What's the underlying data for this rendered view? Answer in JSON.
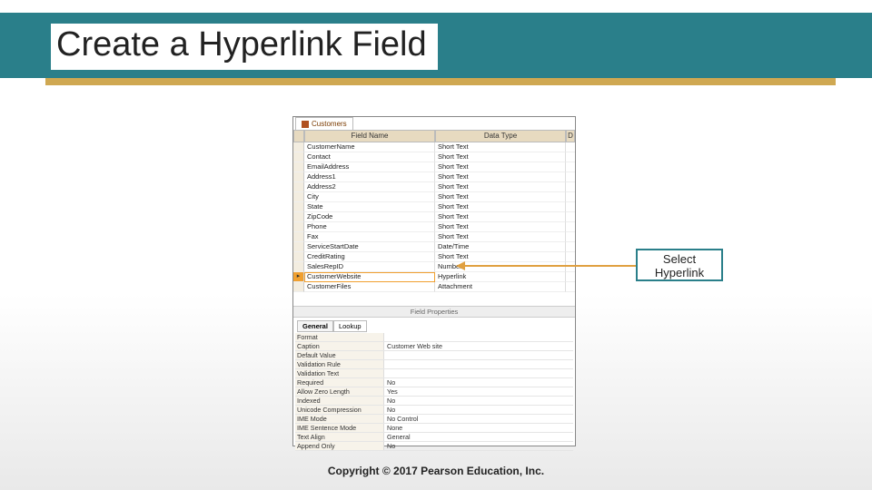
{
  "title": "Create a Hyperlink Field",
  "tab_name": "Customers",
  "headers": {
    "field": "Field Name",
    "type": "Data Type",
    "desc": "D"
  },
  "rows": [
    {
      "name": "CustomerName",
      "type": "Short Text"
    },
    {
      "name": "Contact",
      "type": "Short Text"
    },
    {
      "name": "EmailAddress",
      "type": "Short Text"
    },
    {
      "name": "Address1",
      "type": "Short Text"
    },
    {
      "name": "Address2",
      "type": "Short Text"
    },
    {
      "name": "City",
      "type": "Short Text"
    },
    {
      "name": "State",
      "type": "Short Text"
    },
    {
      "name": "ZipCode",
      "type": "Short Text"
    },
    {
      "name": "Phone",
      "type": "Short Text"
    },
    {
      "name": "Fax",
      "type": "Short Text"
    },
    {
      "name": "ServiceStartDate",
      "type": "Date/Time"
    },
    {
      "name": "CreditRating",
      "type": "Short Text"
    },
    {
      "name": "SalesRepID",
      "type": "Number"
    },
    {
      "name": "CustomerWebsite",
      "type": "Hyperlink",
      "selected": true
    },
    {
      "name": "CustomerFiles",
      "type": "Attachment"
    }
  ],
  "field_properties_label": "Field Properties",
  "prop_tabs": {
    "general": "General",
    "lookup": "Lookup"
  },
  "props": [
    {
      "label": "Format",
      "value": ""
    },
    {
      "label": "Caption",
      "value": "Customer Web site"
    },
    {
      "label": "Default Value",
      "value": ""
    },
    {
      "label": "Validation Rule",
      "value": ""
    },
    {
      "label": "Validation Text",
      "value": ""
    },
    {
      "label": "Required",
      "value": "No"
    },
    {
      "label": "Allow Zero Length",
      "value": "Yes"
    },
    {
      "label": "Indexed",
      "value": "No"
    },
    {
      "label": "Unicode Compression",
      "value": "No"
    },
    {
      "label": "IME Mode",
      "value": "No Control"
    },
    {
      "label": "IME Sentence Mode",
      "value": "None"
    },
    {
      "label": "Text Align",
      "value": "General"
    },
    {
      "label": "Append Only",
      "value": "No"
    }
  ],
  "callout": {
    "line1": "Select",
    "line2": "Hyperlink"
  },
  "copyright": "Copyright © 2017 Pearson Education, Inc."
}
